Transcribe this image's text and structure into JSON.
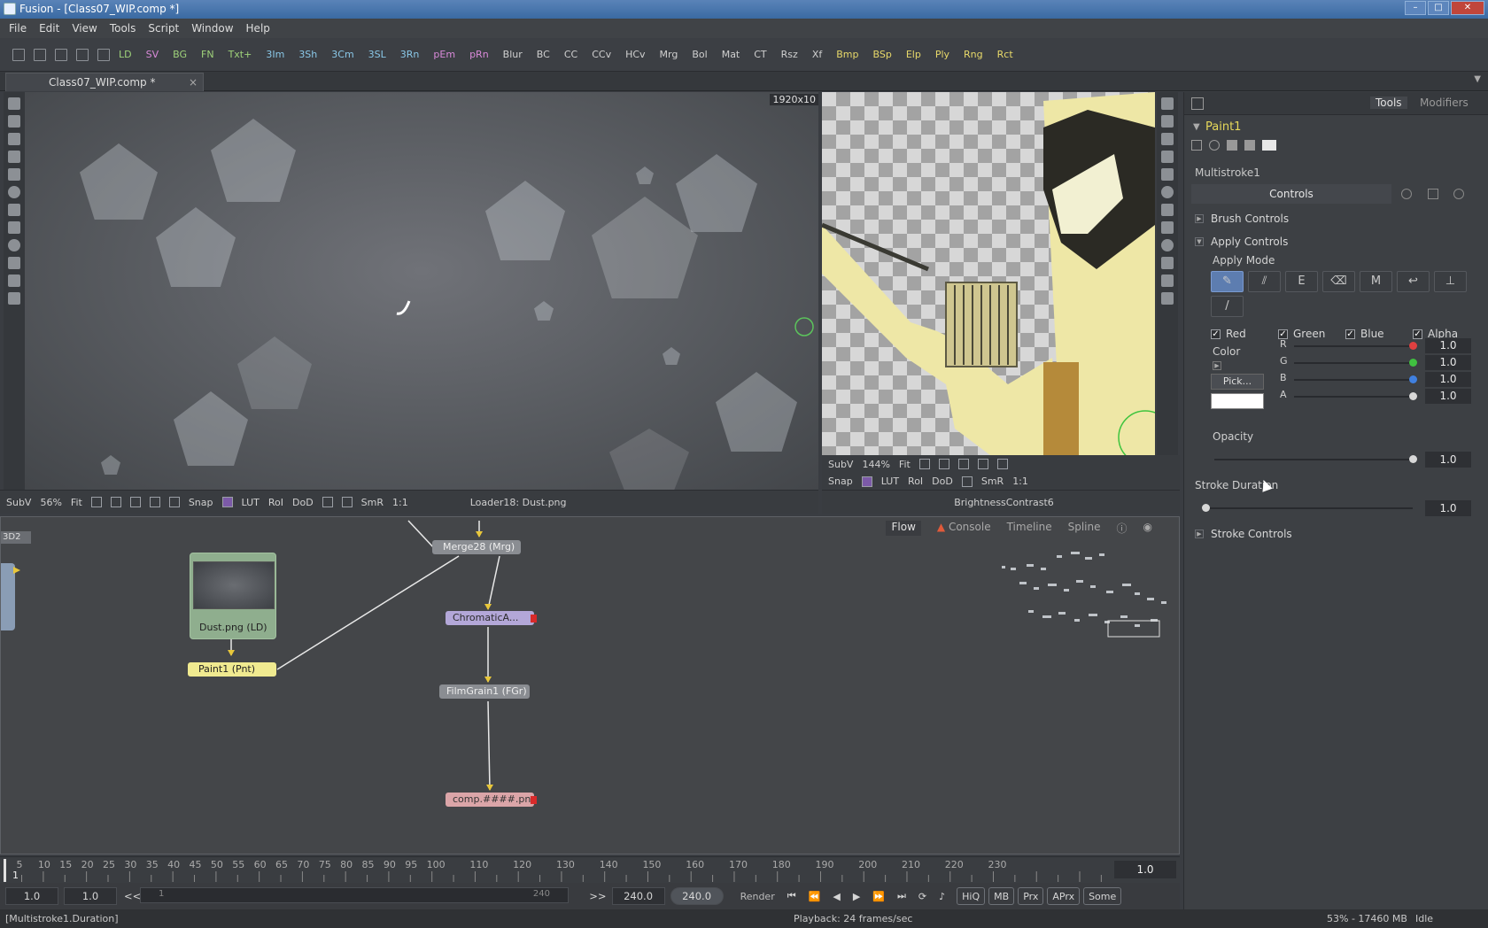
{
  "title_bar": {
    "text": "Fusion - [Class07_WIP.comp *]"
  },
  "menu": [
    "File",
    "Edit",
    "View",
    "Tools",
    "Script",
    "Window",
    "Help"
  ],
  "toolbar": {
    "tools": [
      {
        "label": "LD",
        "tone": "g"
      },
      {
        "label": "SV",
        "tone": "p"
      },
      {
        "label": "BG",
        "tone": "g"
      },
      {
        "label": "FN",
        "tone": "g"
      },
      {
        "label": "Txt+",
        "tone": "g"
      },
      {
        "label": "3Im",
        "tone": "c"
      },
      {
        "label": "3Sh",
        "tone": "c"
      },
      {
        "label": "3Cm",
        "tone": "c"
      },
      {
        "label": "3SL",
        "tone": "c"
      },
      {
        "label": "3Rn",
        "tone": "c"
      },
      {
        "label": "pEm",
        "tone": "p"
      },
      {
        "label": "pRn",
        "tone": "p"
      },
      {
        "label": "Blur",
        "tone": ""
      },
      {
        "label": "BC",
        "tone": ""
      },
      {
        "label": "CC",
        "tone": ""
      },
      {
        "label": "CCv",
        "tone": ""
      },
      {
        "label": "HCv",
        "tone": ""
      },
      {
        "label": "Mrg",
        "tone": ""
      },
      {
        "label": "Bol",
        "tone": ""
      },
      {
        "label": "Mat",
        "tone": ""
      },
      {
        "label": "CT",
        "tone": ""
      },
      {
        "label": "Rsz",
        "tone": ""
      },
      {
        "label": "Xf",
        "tone": ""
      },
      {
        "label": "Bmp",
        "tone": "y"
      },
      {
        "label": "BSp",
        "tone": "y"
      },
      {
        "label": "Elp",
        "tone": "y"
      },
      {
        "label": "Ply",
        "tone": "y"
      },
      {
        "label": "Rng",
        "tone": "y"
      },
      {
        "label": "Rct",
        "tone": "y"
      }
    ]
  },
  "doc_tab": {
    "label": "Class07_WIP.comp *",
    "close": "×"
  },
  "viewer_left": {
    "resolution": "1920x10",
    "bar": {
      "subv": "SubV",
      "zoom": "56%",
      "fit": "Fit",
      "snap": "Snap",
      "lut": "LUT",
      "roi": "RoI",
      "dod": "DoD",
      "smr": "SmR",
      "one": "1:1",
      "loader": "Loader18: Dust.png"
    }
  },
  "viewer_right": {
    "bar": {
      "subv": "SubV",
      "zoom": "144%",
      "fit": "Fit",
      "snap": "Snap",
      "lut": "LUT",
      "roi": "RoI",
      "dod": "DoD",
      "smr": "SmR",
      "one": "1:1",
      "node": "BrightnessContrast6"
    }
  },
  "flow": {
    "tabs": {
      "flow": "Flow",
      "console": "Console",
      "timeline": "Timeline",
      "spline": "Spline"
    },
    "edge_label": "3D2",
    "nodes": {
      "dust": "Dust.png  (LD)",
      "paint": "Paint1  (Pnt)",
      "merge": "Merge28  (Mrg)",
      "chromatic": "ChromaticA...",
      "filmgrain": "FilmGrain1  (FGr)",
      "comp": "comp.####.png"
    }
  },
  "timeline": {
    "ticks": [
      "5",
      "10",
      "15",
      "20",
      "25",
      "30",
      "35",
      "40",
      "45",
      "50",
      "55",
      "60",
      "65",
      "70",
      "75",
      "80",
      "85",
      "90",
      "95",
      "100",
      "110",
      "120",
      "130",
      "140",
      "150",
      "160",
      "170",
      "180",
      "190",
      "200",
      "210",
      "220",
      "230"
    ],
    "start_marker": "1",
    "right_value": "1.0"
  },
  "transport": {
    "field1": "1.0",
    "field2": "1.0",
    "back": "<<",
    "range_start": "1",
    "range_end": "240",
    "fwd": ">>",
    "end": "240.0",
    "current": "240.0",
    "render": "Render",
    "buttons": [
      "HiQ",
      "MB",
      "Prx",
      "APrx",
      "Some"
    ]
  },
  "status": {
    "left": "[Multistroke1.Duration]",
    "center": "Playback: 24 frames/sec",
    "mem": "53% - 17460 MB",
    "state": "Idle"
  },
  "panel": {
    "tabs": {
      "tools": "Tools",
      "modifiers": "Modifiers"
    },
    "tool_name": "Paint1",
    "stroke_name": "Multistroke1",
    "controls_tab": "Controls",
    "brush_controls": "Brush Controls",
    "apply_controls": "Apply Controls",
    "apply_mode": "Apply Mode",
    "channels": [
      {
        "label": "Red",
        "checked": true
      },
      {
        "label": "Green",
        "checked": true
      },
      {
        "label": "Blue",
        "checked": true
      },
      {
        "label": "Alpha",
        "checked": true
      }
    ],
    "color_label": "Color",
    "pick": "Pick...",
    "swatch": "#ffffff",
    "color_channels": [
      {
        "name": "R",
        "value": "1.0",
        "fraction": 1.0,
        "dot": "#e04040"
      },
      {
        "name": "G",
        "value": "1.0",
        "fraction": 1.0,
        "dot": "#40c040"
      },
      {
        "name": "B",
        "value": "1.0",
        "fraction": 1.0,
        "dot": "#4080e0"
      },
      {
        "name": "A",
        "value": "1.0",
        "fraction": 1.0,
        "dot": "#d8d8d8"
      }
    ],
    "opacity_label": "Opacity",
    "opacity": {
      "value": "1.0",
      "fraction": 1.0
    },
    "stroke_duration_label": "Stroke Duration",
    "stroke_duration": {
      "value": "1.0",
      "fraction": 0.0
    },
    "stroke_controls": "Stroke Controls"
  }
}
